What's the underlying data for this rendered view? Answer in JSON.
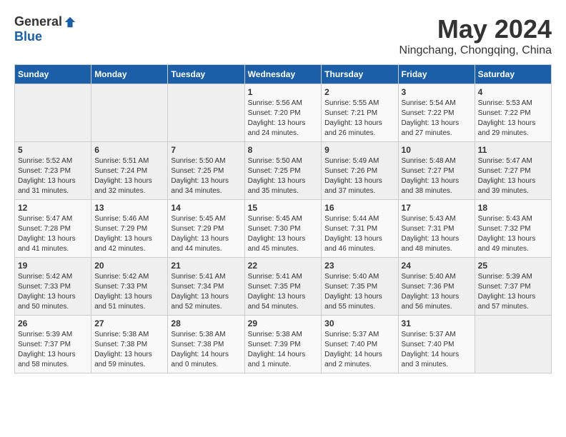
{
  "logo": {
    "general": "General",
    "blue": "Blue"
  },
  "title": {
    "month": "May 2024",
    "location": "Ningchang, Chongqing, China"
  },
  "headers": [
    "Sunday",
    "Monday",
    "Tuesday",
    "Wednesday",
    "Thursday",
    "Friday",
    "Saturday"
  ],
  "weeks": [
    [
      {
        "day": "",
        "info": ""
      },
      {
        "day": "",
        "info": ""
      },
      {
        "day": "",
        "info": ""
      },
      {
        "day": "1",
        "info": "Sunrise: 5:56 AM\nSunset: 7:20 PM\nDaylight: 13 hours\nand 24 minutes."
      },
      {
        "day": "2",
        "info": "Sunrise: 5:55 AM\nSunset: 7:21 PM\nDaylight: 13 hours\nand 26 minutes."
      },
      {
        "day": "3",
        "info": "Sunrise: 5:54 AM\nSunset: 7:22 PM\nDaylight: 13 hours\nand 27 minutes."
      },
      {
        "day": "4",
        "info": "Sunrise: 5:53 AM\nSunset: 7:22 PM\nDaylight: 13 hours\nand 29 minutes."
      }
    ],
    [
      {
        "day": "5",
        "info": "Sunrise: 5:52 AM\nSunset: 7:23 PM\nDaylight: 13 hours\nand 31 minutes."
      },
      {
        "day": "6",
        "info": "Sunrise: 5:51 AM\nSunset: 7:24 PM\nDaylight: 13 hours\nand 32 minutes."
      },
      {
        "day": "7",
        "info": "Sunrise: 5:50 AM\nSunset: 7:25 PM\nDaylight: 13 hours\nand 34 minutes."
      },
      {
        "day": "8",
        "info": "Sunrise: 5:50 AM\nSunset: 7:25 PM\nDaylight: 13 hours\nand 35 minutes."
      },
      {
        "day": "9",
        "info": "Sunrise: 5:49 AM\nSunset: 7:26 PM\nDaylight: 13 hours\nand 37 minutes."
      },
      {
        "day": "10",
        "info": "Sunrise: 5:48 AM\nSunset: 7:27 PM\nDaylight: 13 hours\nand 38 minutes."
      },
      {
        "day": "11",
        "info": "Sunrise: 5:47 AM\nSunset: 7:27 PM\nDaylight: 13 hours\nand 39 minutes."
      }
    ],
    [
      {
        "day": "12",
        "info": "Sunrise: 5:47 AM\nSunset: 7:28 PM\nDaylight: 13 hours\nand 41 minutes."
      },
      {
        "day": "13",
        "info": "Sunrise: 5:46 AM\nSunset: 7:29 PM\nDaylight: 13 hours\nand 42 minutes."
      },
      {
        "day": "14",
        "info": "Sunrise: 5:45 AM\nSunset: 7:29 PM\nDaylight: 13 hours\nand 44 minutes."
      },
      {
        "day": "15",
        "info": "Sunrise: 5:45 AM\nSunset: 7:30 PM\nDaylight: 13 hours\nand 45 minutes."
      },
      {
        "day": "16",
        "info": "Sunrise: 5:44 AM\nSunset: 7:31 PM\nDaylight: 13 hours\nand 46 minutes."
      },
      {
        "day": "17",
        "info": "Sunrise: 5:43 AM\nSunset: 7:31 PM\nDaylight: 13 hours\nand 48 minutes."
      },
      {
        "day": "18",
        "info": "Sunrise: 5:43 AM\nSunset: 7:32 PM\nDaylight: 13 hours\nand 49 minutes."
      }
    ],
    [
      {
        "day": "19",
        "info": "Sunrise: 5:42 AM\nSunset: 7:33 PM\nDaylight: 13 hours\nand 50 minutes."
      },
      {
        "day": "20",
        "info": "Sunrise: 5:42 AM\nSunset: 7:33 PM\nDaylight: 13 hours\nand 51 minutes."
      },
      {
        "day": "21",
        "info": "Sunrise: 5:41 AM\nSunset: 7:34 PM\nDaylight: 13 hours\nand 52 minutes."
      },
      {
        "day": "22",
        "info": "Sunrise: 5:41 AM\nSunset: 7:35 PM\nDaylight: 13 hours\nand 54 minutes."
      },
      {
        "day": "23",
        "info": "Sunrise: 5:40 AM\nSunset: 7:35 PM\nDaylight: 13 hours\nand 55 minutes."
      },
      {
        "day": "24",
        "info": "Sunrise: 5:40 AM\nSunset: 7:36 PM\nDaylight: 13 hours\nand 56 minutes."
      },
      {
        "day": "25",
        "info": "Sunrise: 5:39 AM\nSunset: 7:37 PM\nDaylight: 13 hours\nand 57 minutes."
      }
    ],
    [
      {
        "day": "26",
        "info": "Sunrise: 5:39 AM\nSunset: 7:37 PM\nDaylight: 13 hours\nand 58 minutes."
      },
      {
        "day": "27",
        "info": "Sunrise: 5:38 AM\nSunset: 7:38 PM\nDaylight: 13 hours\nand 59 minutes."
      },
      {
        "day": "28",
        "info": "Sunrise: 5:38 AM\nSunset: 7:38 PM\nDaylight: 14 hours\nand 0 minutes."
      },
      {
        "day": "29",
        "info": "Sunrise: 5:38 AM\nSunset: 7:39 PM\nDaylight: 14 hours\nand 1 minute."
      },
      {
        "day": "30",
        "info": "Sunrise: 5:37 AM\nSunset: 7:40 PM\nDaylight: 14 hours\nand 2 minutes."
      },
      {
        "day": "31",
        "info": "Sunrise: 5:37 AM\nSunset: 7:40 PM\nDaylight: 14 hours\nand 3 minutes."
      },
      {
        "day": "",
        "info": ""
      }
    ]
  ]
}
